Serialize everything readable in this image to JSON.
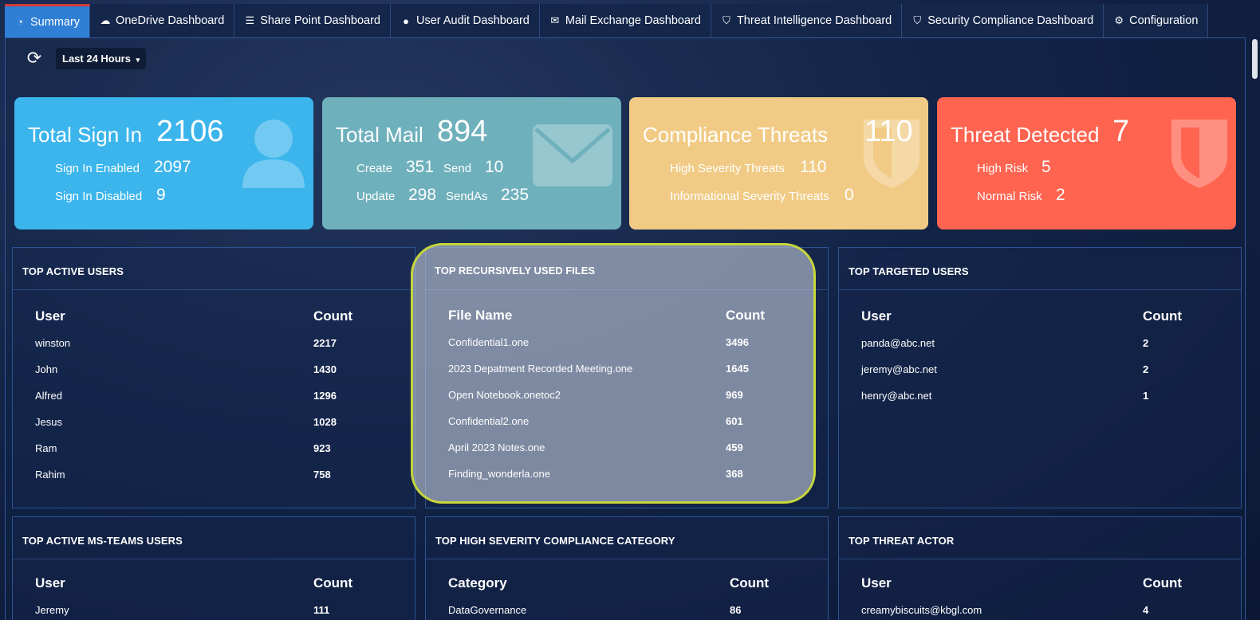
{
  "tabs": [
    {
      "label": "Summary",
      "icon": "dashboard-icon",
      "glyph": "◔"
    },
    {
      "label": "OneDrive Dashboard",
      "icon": "cloud-icon",
      "glyph": "☁"
    },
    {
      "label": "Share Point Dashboard",
      "icon": "list-icon",
      "glyph": "☰"
    },
    {
      "label": "User Audit Dashboard",
      "icon": "user-icon",
      "glyph": "●"
    },
    {
      "label": "Mail Exchange Dashboard",
      "icon": "envelope-icon",
      "glyph": "✉"
    },
    {
      "label": "Threat Intelligence Dashboard",
      "icon": "shield-icon",
      "glyph": "⛉"
    },
    {
      "label": "Security Compliance Dashboard",
      "icon": "shield-icon",
      "glyph": "⛉"
    },
    {
      "label": "Configuration",
      "icon": "gear-icon",
      "glyph": "⚙"
    }
  ],
  "toolbar": {
    "refresh_glyph": "⟳",
    "range_label": "Last 24 Hours",
    "caret": "▾"
  },
  "cards": {
    "signin": {
      "title": "Total Sign In",
      "value": "2106",
      "enabled_label": "Sign In Enabled",
      "enabled_value": "2097",
      "disabled_label": "Sign In Disabled",
      "disabled_value": "9",
      "color": "#3bb5ec"
    },
    "mail": {
      "title": "Total Mail",
      "value": "894",
      "create_label": "Create",
      "create_value": "351",
      "send_label": "Send",
      "send_value": "10",
      "update_label": "Update",
      "update_value": "298",
      "sendas_label": "SendAs",
      "sendas_value": "235",
      "color": "#6eb0bc"
    },
    "compliance": {
      "title": "Compliance Threats",
      "value": "110",
      "high_label": "High Severity Threats",
      "high_value": "110",
      "info_label": "Informational Severity Threats",
      "info_value": "0",
      "color": "#f1cb85"
    },
    "threat": {
      "title": "Threat Detected",
      "value": "7",
      "high_label": "High Risk",
      "high_value": "5",
      "normal_label": "Normal Risk",
      "normal_value": "2",
      "color": "#ff6450"
    }
  },
  "panels": {
    "active_users": {
      "title": "TOP ACTIVE USERS",
      "col1": "User",
      "col2": "Count",
      "rows": [
        {
          "name": "winston",
          "count": "2217"
        },
        {
          "name": "John",
          "count": "1430"
        },
        {
          "name": "Alfred",
          "count": "1296"
        },
        {
          "name": "Jesus",
          "count": "1028"
        },
        {
          "name": "Ram",
          "count": "923"
        },
        {
          "name": "Rahim",
          "count": "758"
        }
      ]
    },
    "files": {
      "title": "TOP RECURSIVELY USED FILES",
      "col1": "File Name",
      "col2": "Count",
      "rows": [
        {
          "name": "Confidential1.one",
          "count": "3496"
        },
        {
          "name": "2023 Depatment Recorded Meeting.one",
          "count": "1645"
        },
        {
          "name": "Open Notebook.onetoc2",
          "count": "969"
        },
        {
          "name": "Confidential2.one",
          "count": "601"
        },
        {
          "name": "April 2023 Notes.one",
          "count": "459"
        },
        {
          "name": "Finding_wonderla.one",
          "count": "368"
        }
      ]
    },
    "targeted": {
      "title": "TOP TARGETED USERS",
      "col1": "User",
      "col2": "Count",
      "rows": [
        {
          "name": "panda@abc.net",
          "count": "2"
        },
        {
          "name": "jeremy@abc.net",
          "count": "2"
        },
        {
          "name": "henry@abc.net",
          "count": "1"
        }
      ]
    },
    "teams": {
      "title": "TOP ACTIVE MS-TEAMS USERS",
      "col1": "User",
      "col2": "Count",
      "rows": [
        {
          "name": "Jeremy",
          "count": "111"
        }
      ]
    },
    "compliance_cat": {
      "title": "TOP HIGH SEVERITY COMPLIANCE CATEGORY",
      "col1": "Category",
      "col2": "Count",
      "rows": [
        {
          "name": "DataGovernance",
          "count": "86"
        }
      ]
    },
    "actor": {
      "title": "TOP THREAT ACTOR",
      "col1": "User",
      "col2": "Count",
      "rows": [
        {
          "name": "creamybiscuits@kbgl.com",
          "count": "4"
        }
      ]
    }
  }
}
